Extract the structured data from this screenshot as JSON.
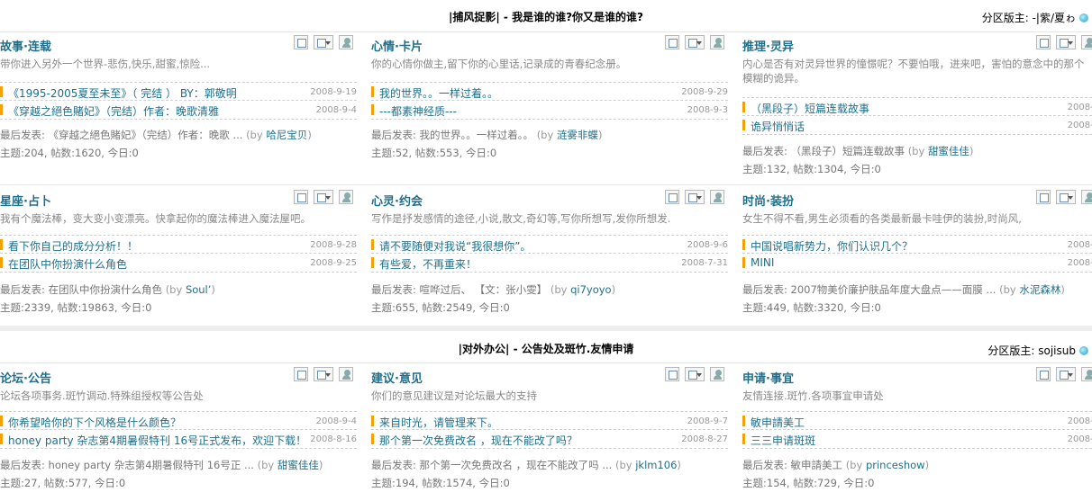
{
  "sections": [
    {
      "title": "|捕风捉影| - 我是谁的谁?你又是谁的谁?",
      "moderator": "分区版主: -|紫/夏ゎ",
      "rows": [
        [
          {
            "name": "故事·连载",
            "desc": "带你进入另外一个世界-悲伤,快乐,甜蜜,惊险...",
            "topics": [
              {
                "title": "《1995-2005夏至未至》（ 完结 ） BY：郭敬明",
                "date": "2008-9-19"
              },
              {
                "title": "《穿越之絕色賭妃》（完结）作者：晚歌清雅",
                "date": "2008-9-4"
              }
            ],
            "last_label": "最后发表: 《穿越之絕色賭妃》（完结）作者：晚歌 ...",
            "last_by": "(by",
            "last_author": "哈尼宝贝",
            "last_close": ")",
            "stats": "主题:204, 帖数:1620, 今日:0"
          },
          {
            "name": "心情·卡片",
            "desc": "你的心情你做主,留下你的心里话,记录成的青春纪念册。",
            "topics": [
              {
                "title": "我的世界。。一样过着。。",
                "date": "2008-9-29"
              },
              {
                "title": "---都素神经质---",
                "date": "2008-9-3"
              }
            ],
            "last_label": "最后发表: 我的世界。。一样过着。。",
            "last_by": "(by",
            "last_author": "涟雾非蝶",
            "last_close": ")",
            "stats": "主题:52, 帖数:553, 今日:0"
          },
          {
            "name": "推理·灵异",
            "desc": "内心是否有对灵异世界的憧憬呢？不要怕哦，进来吧，害怕的意念中的那个模糊的诡异。",
            "topics": [
              {
                "title": "（黑段子）短篇连载故事",
                "date": "2008-9-2"
              },
              {
                "title": "诡异悄悄话",
                "date": "2008-9-2"
              }
            ],
            "last_label": "最后发表: （黑段子）短篇连载故事",
            "last_by": "(by",
            "last_author": "甜蜜佳佳",
            "last_close": ")",
            "stats": "主题:132, 帖数:1304, 今日:0"
          }
        ],
        [
          {
            "name": "星座·占卜",
            "desc": "我有个魔法棒，变大变小变漂亮。快拿起你的魔法棒进入魔法屋吧。",
            "topics": [
              {
                "title": "看下你自己的成分分析！！",
                "date": "2008-9-28"
              },
              {
                "title": "在团队中你扮演什么角色",
                "date": "2008-9-25"
              }
            ],
            "last_label": "最后发表: 在团队中你扮演什么角色",
            "last_by": "(by",
            "last_author": "Soul’",
            "last_close": ")",
            "stats": "主题:2339, 帖数:19863, 今日:0"
          },
          {
            "name": "心灵·约会",
            "desc": "写作是抒发感情的途径,小说,散文,奇幻等,写你所想写,发你所想发.",
            "topics": [
              {
                "title": "请不要随便对我说“我很想你”。",
                "date": "2008-9-6"
              },
              {
                "title": "有些爱，不再重来！",
                "date": "2008-7-31"
              }
            ],
            "last_label": "最后发表: 喧哗过后、 【文：张小雯】",
            "last_by": "(by",
            "last_author": "qi7yoyo",
            "last_close": ")",
            "stats": "主题:655, 帖数:2549, 今日:0"
          },
          {
            "name": "时尚·装扮",
            "desc": "女生不得不看,男生必须看的各类最新最卡哇伊的装扮,时尚风,",
            "topics": [
              {
                "title": "中国说唱新势力，你们认识几个？",
                "date": "2008-9-2"
              },
              {
                "title": "MINI",
                "date": "2008-9-2"
              }
            ],
            "last_label": "最后发表: 2007物美价廉护肤品年度大盘点——面膜 ...",
            "last_by": "(by",
            "last_author": "水泥森林",
            "last_close": ")",
            "stats": "主题:449, 帖数:3320, 今日:0"
          }
        ]
      ]
    },
    {
      "title": "|对外办公| - 公告处及斑竹.友情申请",
      "moderator": "分区版主: sojisub",
      "rows": [
        [
          {
            "name": "论坛·公告",
            "desc": "论坛各项事务.斑竹调动.特殊组授权等公告处",
            "topics": [
              {
                "title": "你希望哈你的下个风格是什么颜色？",
                "date": "2008-9-4"
              },
              {
                "title": "honey party 杂志第4期暑假特刊 16号正式发布，欢迎下载！",
                "date": "2008-8-16"
              }
            ],
            "last_label": "最后发表: honey party 杂志第4期暑假特刊 16号正 ...",
            "last_by": "(by",
            "last_author": "甜蜜佳佳",
            "last_close": ")",
            "stats": "主题:27, 帖数:577, 今日:0"
          },
          {
            "name": "建议·意见",
            "desc": "你们的意见建议是对论坛最大的支持",
            "topics": [
              {
                "title": "来自时光，请管理来下。",
                "date": "2008-9-7"
              },
              {
                "title": "那个第一次免费改名 ，现在不能改了吗？",
                "date": "2008-8-27"
              }
            ],
            "last_label": "最后发表: 那个第一次免费改名 ，现在不能改了吗 ...",
            "last_by": "(by",
            "last_author": "jklm106",
            "last_close": ")",
            "stats": "主题:194, 帖数:1574, 今日:0"
          },
          {
            "name": "申请·事宜",
            "desc": "友情连接.斑竹.各项事宜申请处",
            "topics": [
              {
                "title": "敏申請美工",
                "date": "2008-9-2"
              },
              {
                "title": "三三申请斑斑",
                "date": "2008-9-2"
              }
            ],
            "last_label": "最后发表: 敏申請美工",
            "last_by": "(by",
            "last_author": "princeshow",
            "last_close": ")",
            "stats": "主题:154, 帖数:729, 今日:0"
          }
        ]
      ]
    }
  ]
}
